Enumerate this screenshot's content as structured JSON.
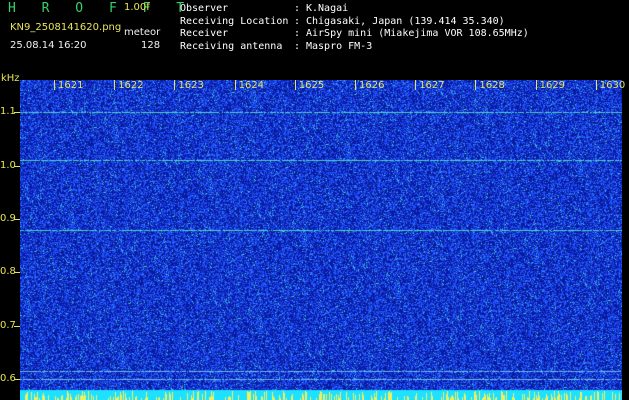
{
  "header": {
    "brand": "H R O F F T",
    "version": "1.00f",
    "filename": "KN9_2508141620.png",
    "mode": "meteor",
    "datetime": "25.08.14 16:20",
    "count": "128"
  },
  "meta": {
    "observer": {
      "key": "Observer",
      "value": "K.Nagai"
    },
    "location": {
      "key": "Receiving Location",
      "value": "Chigasaki, Japan (139.414 35.340)"
    },
    "receiver": {
      "key": "Receiver",
      "value": "AirSpy mini (Miakejima VOR 108.65MHz)"
    },
    "antenna": {
      "key": "Receiving antenna",
      "value": "Maspro FM-3"
    }
  },
  "chart_data": {
    "type": "heatmap",
    "ylabel": "kHz",
    "x_ticks": [
      "1621",
      "1622",
      "1623",
      "1624",
      "1625",
      "1626",
      "1627",
      "1628",
      "1629",
      "1630"
    ],
    "y_ticks": [
      "1.1",
      "1.0",
      "0.9",
      "0.8",
      "0.7",
      "0.6"
    ],
    "yrange": [
      0.58,
      1.16
    ],
    "signal_lines_khz": [
      1.1,
      1.01,
      0.88,
      0.615,
      0.6
    ],
    "colors": {
      "background": "#0a1aa0",
      "noise": "#1e52ff",
      "hot": "#38e0c8",
      "baseline": "#1ee0ff",
      "bottom_bar": "#f0f060"
    }
  }
}
